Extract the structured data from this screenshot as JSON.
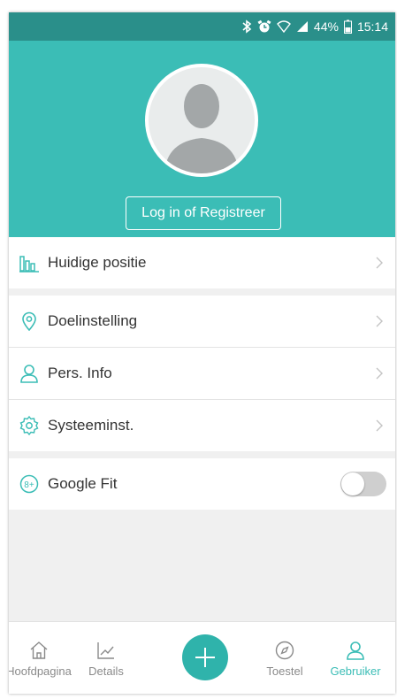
{
  "status_bar": {
    "battery": "44%",
    "time": "15:14"
  },
  "header": {
    "login_label": "Log in of Registreer"
  },
  "menu": {
    "current_position": {
      "label": "Huidige positie",
      "icon": "bar-chart-icon"
    },
    "goal_setting": {
      "label": "Doelinstelling",
      "icon": "location-pin-icon"
    },
    "personal_info": {
      "label": "Pers. Info",
      "icon": "person-icon"
    },
    "system_settings": {
      "label": "Systeeminst.",
      "icon": "gear-icon"
    },
    "google_fit": {
      "label": "Google Fit",
      "icon": "google-fit-icon",
      "enabled": false
    }
  },
  "tabbar": {
    "home": "Hoofdpagina",
    "details": "Details",
    "device": "Toestel",
    "user": "Gebruiker",
    "active": "user"
  },
  "colors": {
    "accent": "#3bbdb6",
    "status_bar": "#2a8f8a"
  }
}
